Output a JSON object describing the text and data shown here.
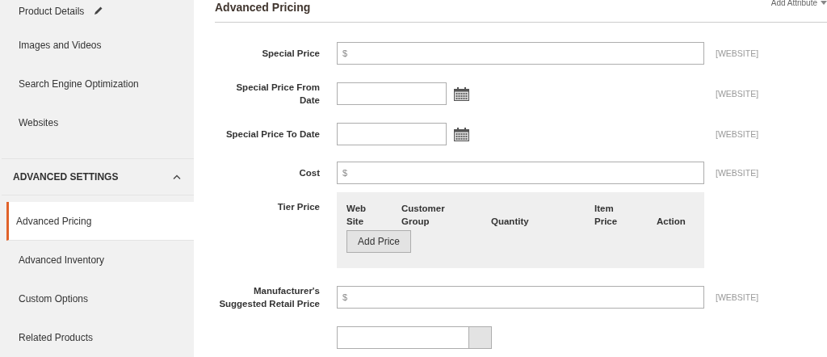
{
  "sidebar": {
    "top_items": [
      {
        "label": "Product Details",
        "edit_icon": true,
        "selected": false
      },
      {
        "label": "Images and Videos",
        "edit_icon": false,
        "selected": false
      },
      {
        "label": "Search Engine Optimization",
        "edit_icon": false,
        "selected": false
      },
      {
        "label": "Websites",
        "edit_icon": false,
        "selected": false
      }
    ],
    "section": {
      "title": "ADVANCED SETTINGS",
      "expanded": true
    },
    "section_items": [
      {
        "label": "Advanced Pricing",
        "selected": true
      },
      {
        "label": "Advanced Inventory",
        "selected": false
      },
      {
        "label": "Custom Options",
        "selected": false
      },
      {
        "label": "Related Products",
        "selected": false
      }
    ]
  },
  "main": {
    "title": "Advanced Pricing",
    "add_attribute": "Add Attribute",
    "fields": [
      {
        "kind": "price",
        "label": "Special Price",
        "prefix": "$",
        "scope": "[WEBSITE]"
      },
      {
        "kind": "date",
        "label": "Special Price From Date",
        "scope": "[WEBSITE]"
      },
      {
        "kind": "date",
        "label": "Special Price To Date",
        "scope": "[WEBSITE]"
      },
      {
        "kind": "price",
        "label": "Cost",
        "prefix": "$",
        "scope": "[WEBSITE]"
      },
      {
        "kind": "tier",
        "label": "Tier Price",
        "columns": [
          "Web Site",
          "Customer Group",
          "Quantity",
          "Item Price",
          "Action"
        ],
        "button": "Add Price"
      },
      {
        "kind": "price",
        "label": "Manufacturer's Suggested Retail Price",
        "prefix": "$",
        "scope": "[WEBSITE]"
      },
      {
        "kind": "select"
      }
    ]
  }
}
